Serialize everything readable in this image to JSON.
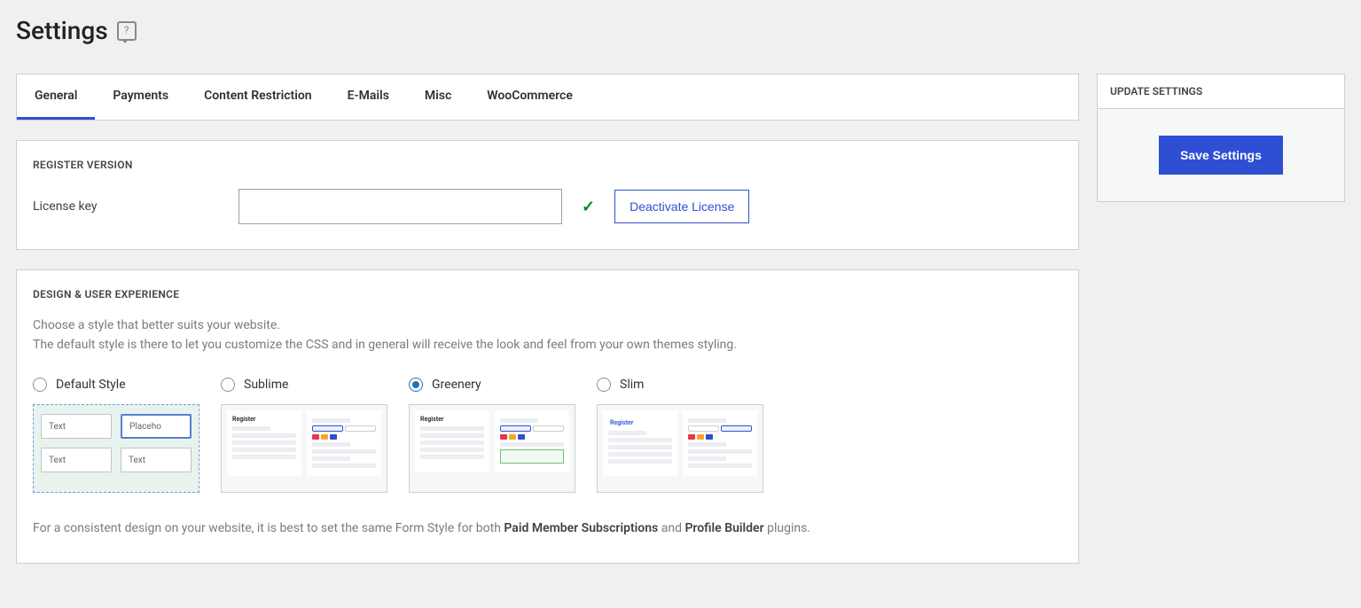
{
  "page": {
    "title": "Settings"
  },
  "tabs": [
    {
      "label": "General",
      "active": true
    },
    {
      "label": "Payments",
      "active": false
    },
    {
      "label": "Content Restriction",
      "active": false
    },
    {
      "label": "E-Mails",
      "active": false
    },
    {
      "label": "Misc",
      "active": false
    },
    {
      "label": "WooCommerce",
      "active": false
    }
  ],
  "register": {
    "section_title": "REGISTER VERSION",
    "license_label": "License key",
    "license_value": "",
    "deactivate_label": "Deactivate License"
  },
  "design": {
    "section_title": "DESIGN & USER EXPERIENCE",
    "desc_line1": "Choose a style that better suits your website.",
    "desc_line2": "The default style is there to let you customize the CSS and in general will receive the look and feel from your own themes styling.",
    "options": [
      {
        "label": "Default Style",
        "checked": false
      },
      {
        "label": "Sublime",
        "checked": false
      },
      {
        "label": "Greenery",
        "checked": true
      },
      {
        "label": "Slim",
        "checked": false
      }
    ],
    "footnote_pre": "For a consistent design on your website, it is best to set the same Form Style for both ",
    "footnote_b1": "Paid Member Subscriptions",
    "footnote_mid": " and ",
    "footnote_b2": "Profile Builder",
    "footnote_post": " plugins."
  },
  "sidebar": {
    "title": "UPDATE SETTINGS",
    "save_label": "Save Settings"
  },
  "preview_text": {
    "text": "Text",
    "placeholder": "Placeho",
    "register": "Register"
  }
}
